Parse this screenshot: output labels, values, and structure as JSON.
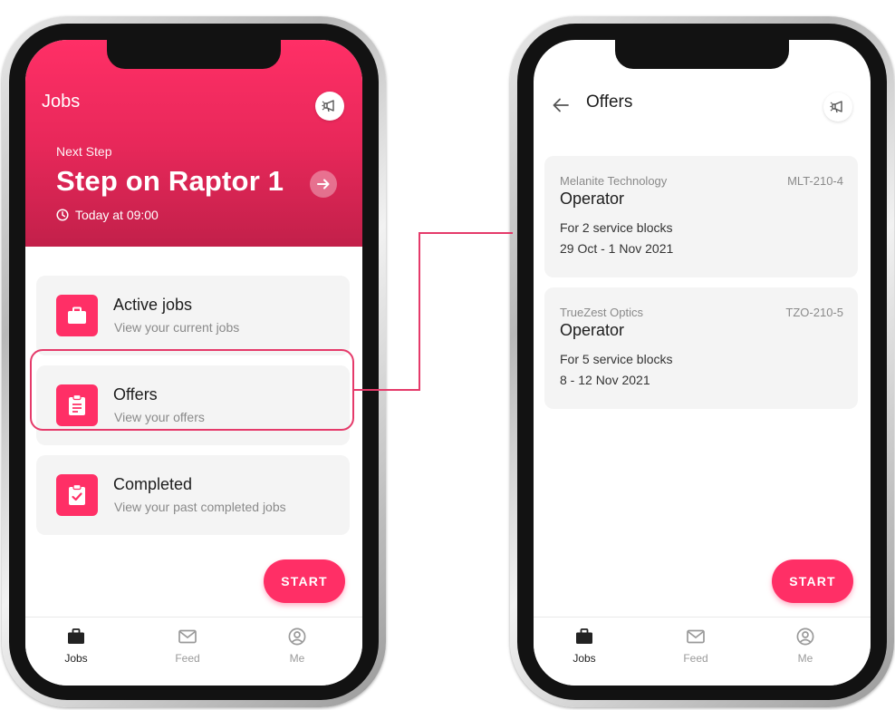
{
  "colors": {
    "accent": "#ff2f66",
    "connector": "#e53a6a"
  },
  "left_screen": {
    "header": {
      "title": "Jobs",
      "announce_icon": "megaphone-icon",
      "next_step_label": "Next Step",
      "step_title": "Step on Raptor 1",
      "go_icon": "arrow-right-icon",
      "time_icon": "clock-icon",
      "time": "Today at 09:00"
    },
    "menu": [
      {
        "icon": "briefcase-icon",
        "title": "Active jobs",
        "subtitle": "View your current jobs"
      },
      {
        "icon": "clipboard-icon",
        "title": "Offers",
        "subtitle": "View your offers"
      },
      {
        "icon": "clipboard-check-icon",
        "title": "Completed",
        "subtitle": "View your past completed jobs"
      }
    ],
    "start_label": "START"
  },
  "right_screen": {
    "header": {
      "back_icon": "arrow-left-icon",
      "title": "Offers",
      "announce_icon": "megaphone-icon"
    },
    "offers": [
      {
        "company": "Melanite Technology",
        "code": "MLT-210-4",
        "role": "Operator",
        "blocks": "For 2 service blocks",
        "dates": "29 Oct - 1 Nov 2021"
      },
      {
        "company": "TrueZest Optics",
        "code": "TZO-210-5",
        "role": "Operator",
        "blocks": "For 5 service blocks",
        "dates": "8 - 12 Nov 2021"
      }
    ],
    "start_label": "START"
  },
  "bottom_nav": [
    {
      "icon": "briefcase-icon",
      "label": "Jobs",
      "active": true
    },
    {
      "icon": "mail-icon",
      "label": "Feed",
      "active": false
    },
    {
      "icon": "user-circle-icon",
      "label": "Me",
      "active": false
    }
  ]
}
